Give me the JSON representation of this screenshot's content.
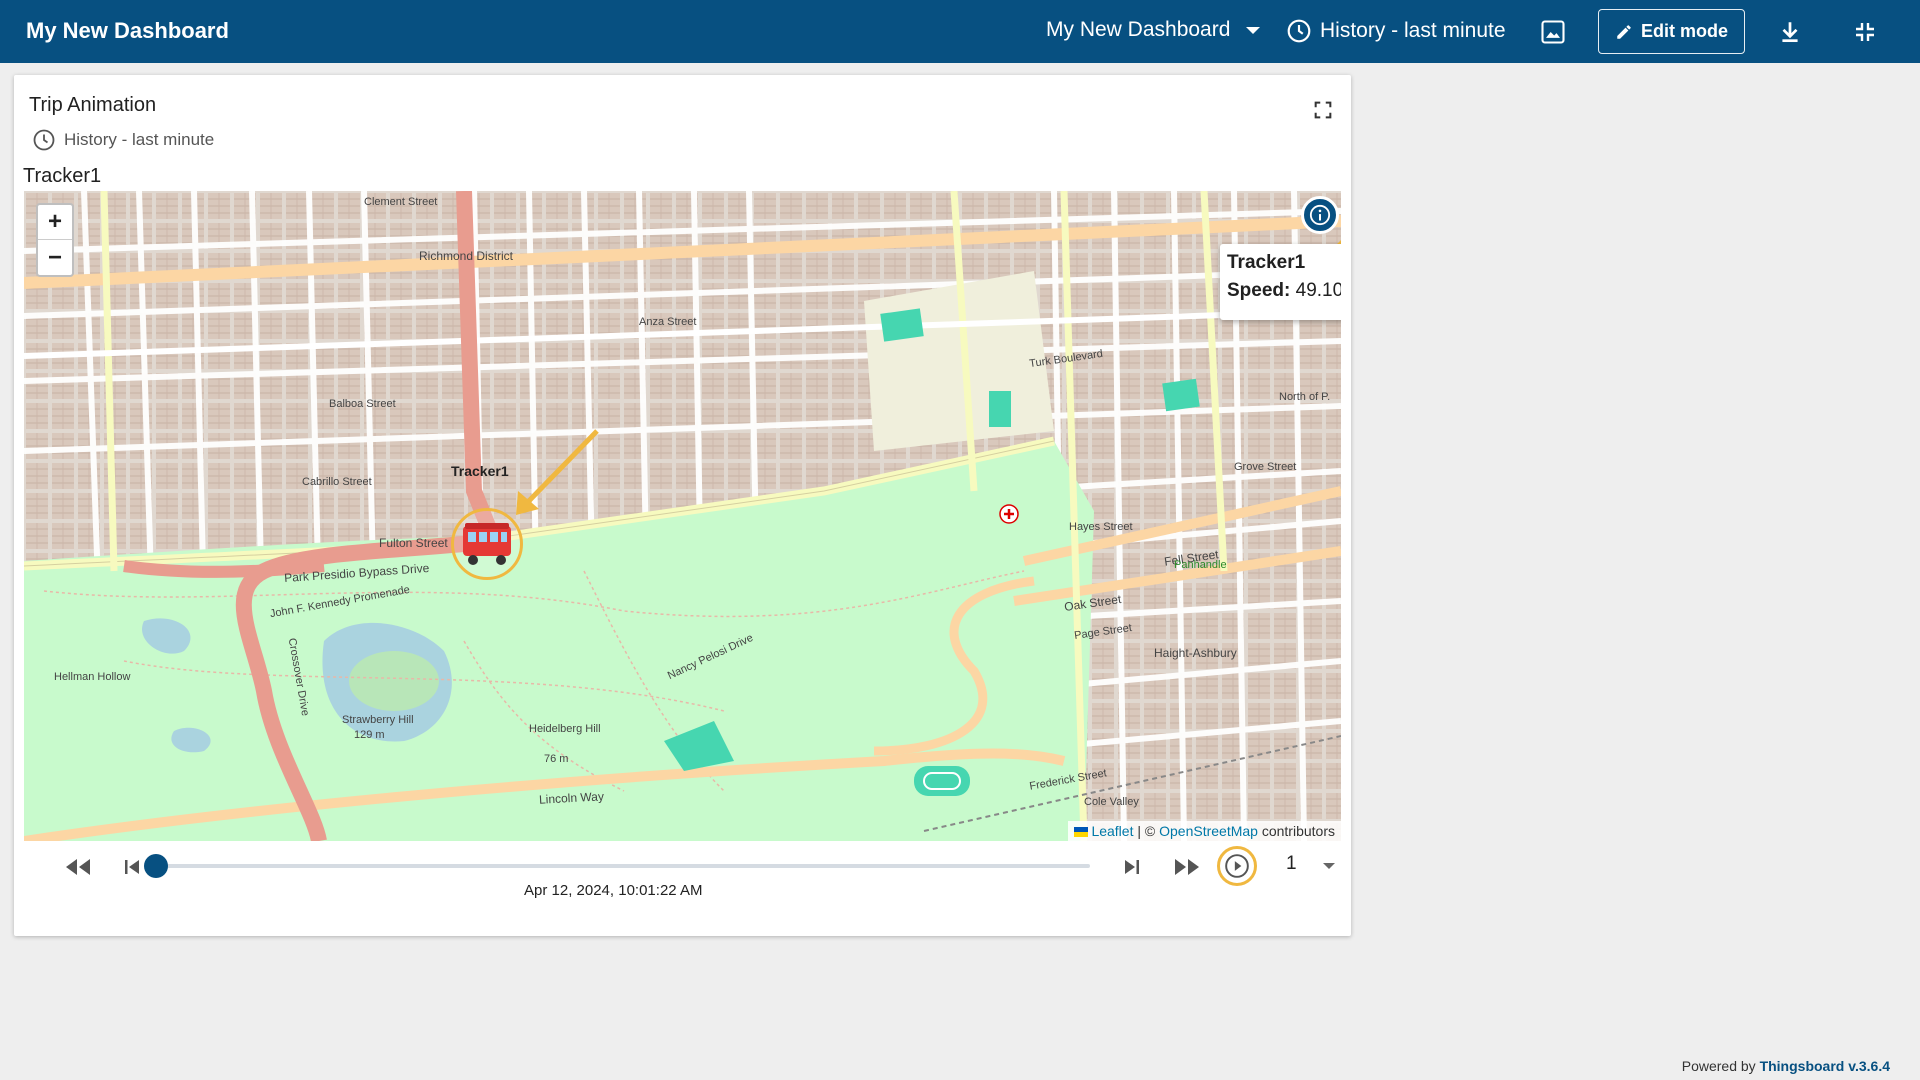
{
  "topbar": {
    "title": "My New Dashboard",
    "dashboard_select": "My New Dashboard",
    "history": "History - last minute",
    "edit_mode": "Edit mode"
  },
  "widget": {
    "title": "Trip Animation",
    "timewindow": "History - last minute",
    "tracker_label": "Tracker1"
  },
  "map": {
    "marker_label": "Tracker1",
    "popup": {
      "name": "Tracker1",
      "speed_label": "Speed:",
      "speed_value": "49.10"
    },
    "attribution": {
      "leaflet": "Leaflet",
      "sep": " | © ",
      "osm": "OpenStreetMap",
      "suffix": " contributors"
    },
    "labels": [
      "Clement Street",
      "Richmond District",
      "Anza Street",
      "Balboa Street",
      "Cabrillo Street",
      "Fulton Street",
      "Park Presidio Bypass Drive",
      "John F. Kennedy Promenade",
      "Turk Boulevard",
      "Fell Street",
      "Oak Street",
      "Page Street",
      "Haight-Ashbury",
      "Hellman Hollow",
      "Strawberry Hill",
      "129 m",
      "Heidelberg Hill",
      "76 m",
      "Nancy Pelosi Drive",
      "Lincoln Way",
      "Frederick Street",
      "Cole Valley",
      "Crossover Drive",
      "Panhandle",
      "Grove Street",
      "Hayes Street",
      "North of P."
    ]
  },
  "player": {
    "timestamp": "Apr 12, 2024, 10:01:22 AM",
    "speed": "1",
    "progress": 0.0
  },
  "footer": {
    "powered_by": "Powered by ",
    "link": "Thingsboard v.3.6.4"
  },
  "colors": {
    "primary": "#075081",
    "highlight": "#f0b840",
    "park": "#c8facc",
    "major_road": "#fcd6a4",
    "arterial": "#e89c8f"
  }
}
